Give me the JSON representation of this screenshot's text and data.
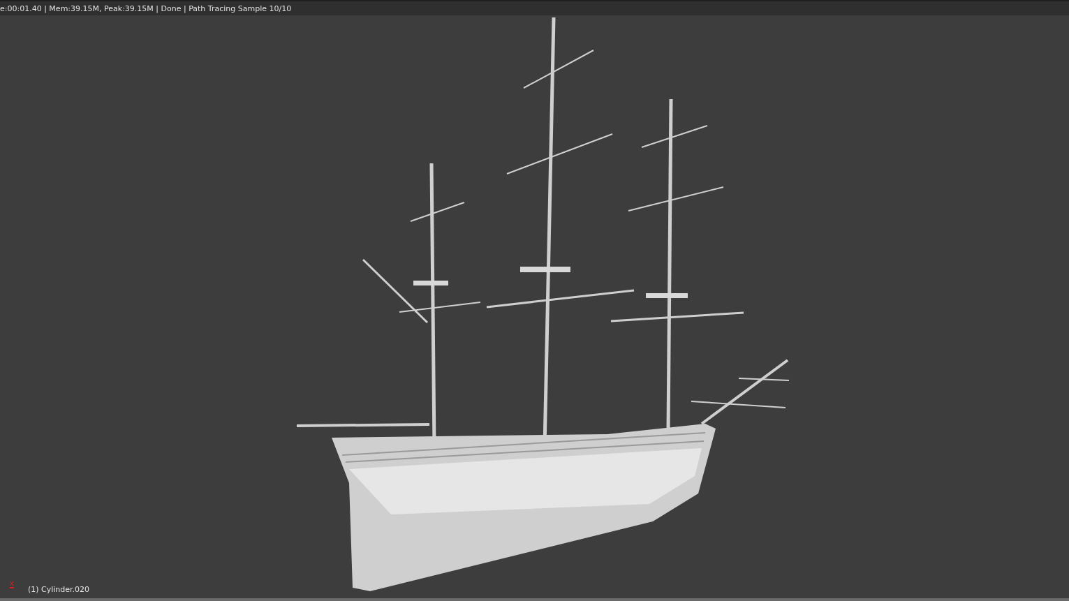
{
  "render_info": "e:00:01.40 | Mem:39.15M, Peak:39.15M | Done | Path Tracing Sample 10/10",
  "viewport": {
    "axis_label": "x",
    "object_label": "(1) Cylinder.020"
  }
}
